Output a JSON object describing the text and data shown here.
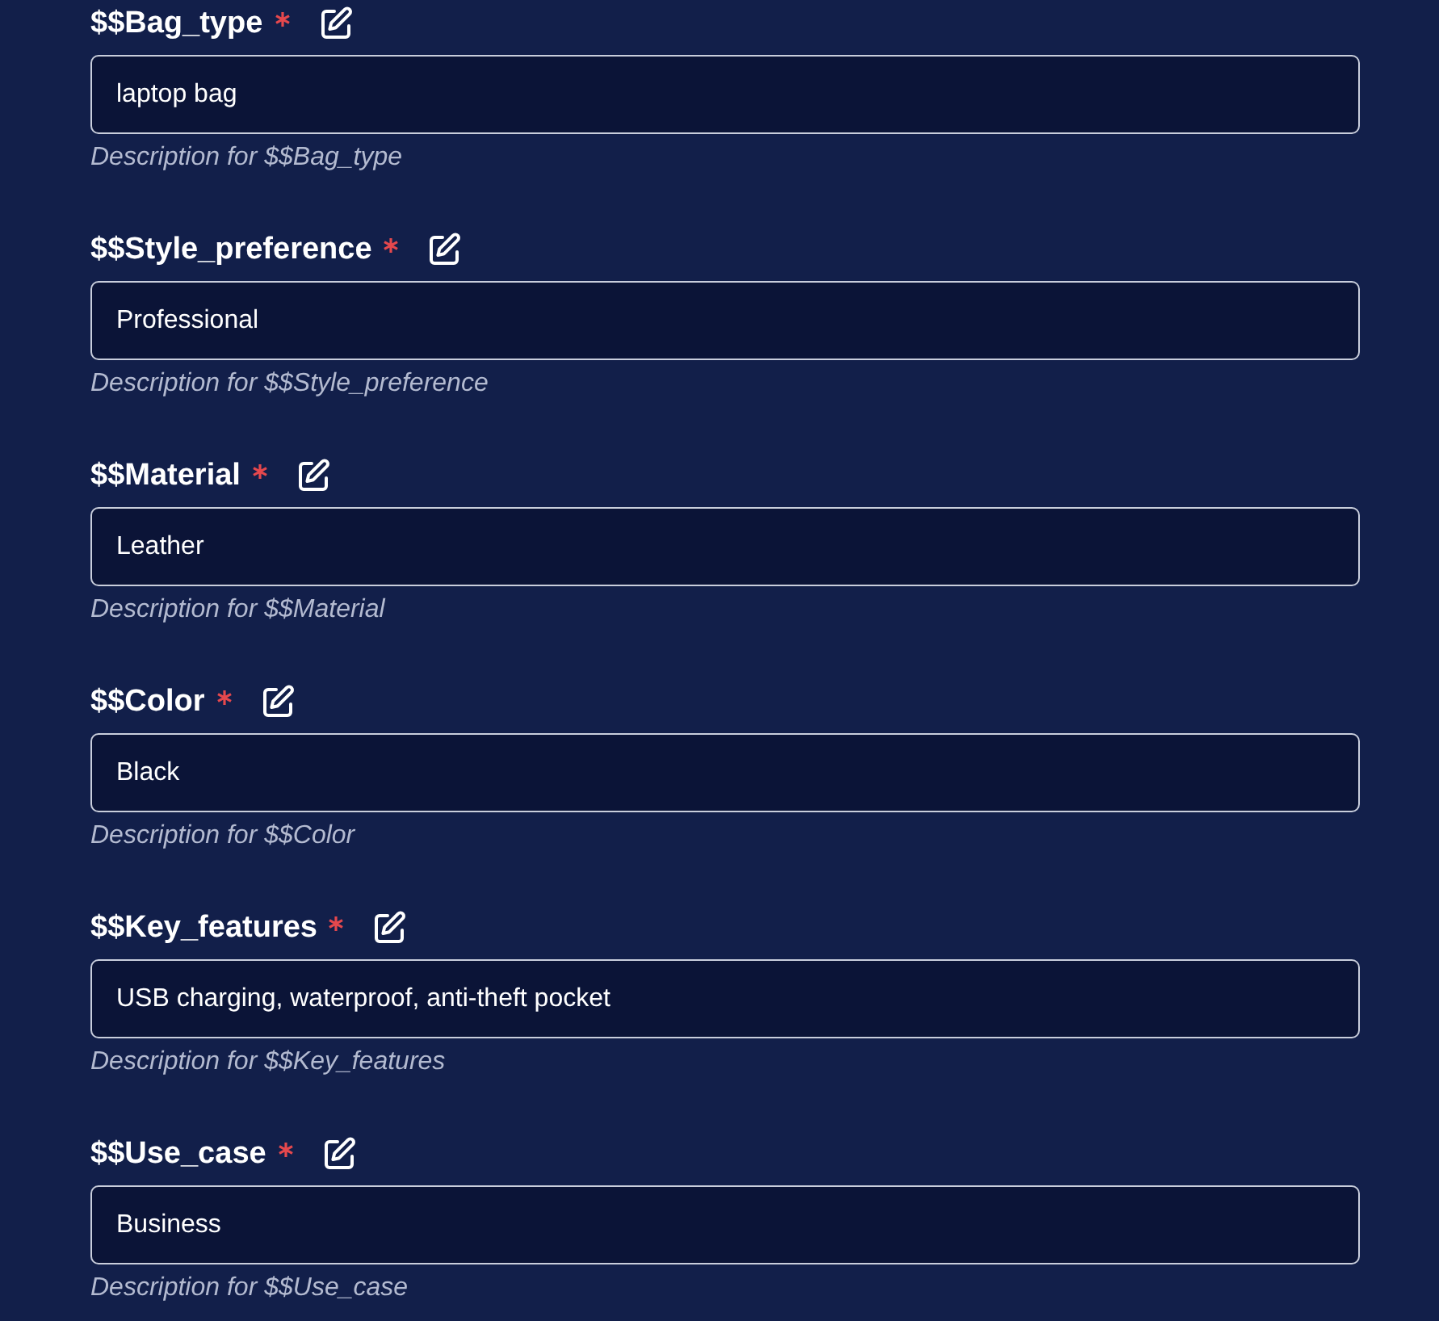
{
  "fields": [
    {
      "label": "$$Bag_type",
      "required": true,
      "value": "laptop bag",
      "description": "Description for $$Bag_type"
    },
    {
      "label": "$$Style_preference",
      "required": true,
      "value": "Professional",
      "description": "Description for $$Style_preference"
    },
    {
      "label": "$$Material",
      "required": true,
      "value": "Leather",
      "description": "Description for $$Material"
    },
    {
      "label": "$$Color",
      "required": true,
      "value": "Black",
      "description": "Description for $$Color"
    },
    {
      "label": "$$Key_features",
      "required": true,
      "value": "USB charging, waterproof, anti-theft pocket",
      "description": "Description for $$Key_features"
    },
    {
      "label": "$$Use_case",
      "required": true,
      "value": "Business",
      "description": "Description for $$Use_case"
    }
  ]
}
